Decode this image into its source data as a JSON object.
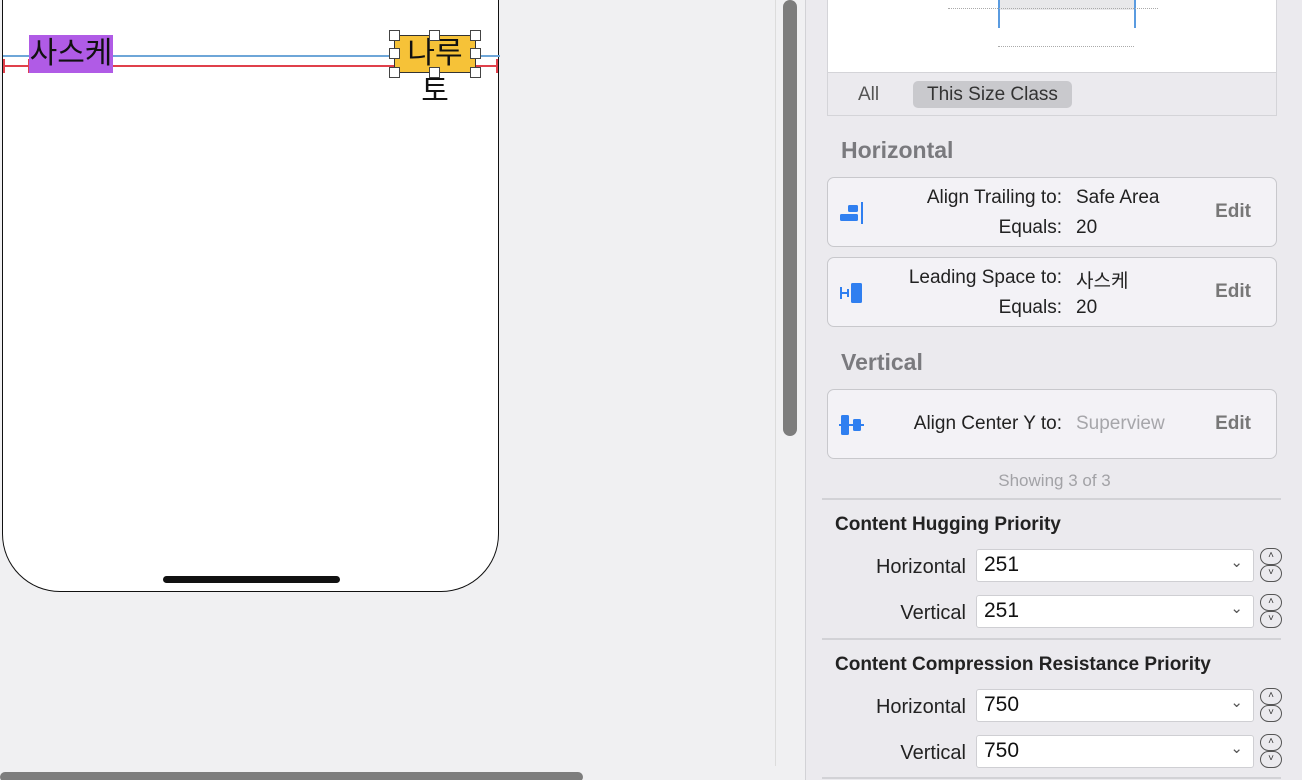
{
  "canvas": {
    "labels": {
      "sasuke": "사스케",
      "naruto": "나루토"
    }
  },
  "inspector": {
    "segmented": {
      "all": "All",
      "this_size_class": "This Size Class"
    },
    "sections": {
      "horizontal": "Horizontal",
      "vertical": "Vertical"
    },
    "constraints": [
      {
        "icon": "align-trailing-icon",
        "key1": "Align Trailing to:",
        "val1": "Safe Area",
        "key2": "Equals:",
        "val2": "20",
        "edit": "Edit"
      },
      {
        "icon": "leading-space-icon",
        "key1": "Leading Space to:",
        "val1": "사스케",
        "key2": "Equals:",
        "val2": "20",
        "edit": "Edit"
      },
      {
        "icon": "align-center-y-icon",
        "key1": "Align Center Y to:",
        "val1": "Superview",
        "edit": "Edit"
      }
    ],
    "showing": "Showing 3 of 3",
    "hugging": {
      "title": "Content Hugging Priority",
      "horizontal_label": "Horizontal",
      "horizontal_value": "251",
      "vertical_label": "Vertical",
      "vertical_value": "251"
    },
    "compression": {
      "title": "Content Compression Resistance Priority",
      "horizontal_label": "Horizontal",
      "horizontal_value": "750",
      "vertical_label": "Vertical",
      "vertical_value": "750"
    }
  },
  "colors": {
    "accent": "#2f7ff0",
    "constraint_red": "#e0404b",
    "label_purple": "#b05be6",
    "label_yellow": "#f6c238"
  }
}
